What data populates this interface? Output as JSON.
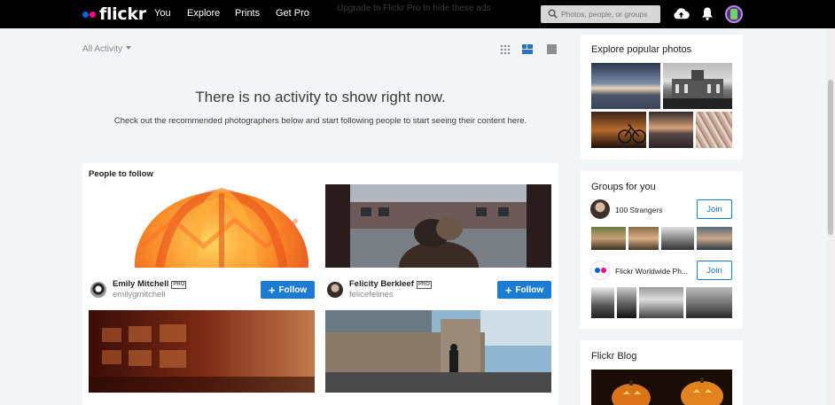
{
  "topbar": {
    "logo_text": "flickr",
    "nav": [
      "You",
      "Explore",
      "Prints",
      "Get Pro"
    ],
    "promo_text": "Upgrade to Flickr Pro to hide these ads",
    "search_placeholder": "Photos, people, or groups",
    "icons": [
      "upload-cloud-icon",
      "bell-icon",
      "user-avatar"
    ]
  },
  "feed": {
    "filter_label": "All Activity",
    "view_modes": [
      "grid-view-icon",
      "mosaic-view-icon",
      "single-view-icon"
    ],
    "empty_title": "There is no activity to show right now.",
    "empty_subtitle": "Check out the recommended photographers below and start following people to start seeing their content here."
  },
  "people_to_follow": {
    "title": "People to follow",
    "pro_badge": "PRO",
    "follow_label": "Follow",
    "people": [
      {
        "name": "Emily Mitchell",
        "username": "emilygmitchell"
      },
      {
        "name": "Felicity Berkleef",
        "username": "felicefelines"
      }
    ]
  },
  "explore": {
    "title": "Explore popular photos"
  },
  "groups": {
    "title": "Groups for you",
    "join_label": "Join",
    "items": [
      {
        "name": "100 Strangers"
      },
      {
        "name": "Flickr Worldwide Ph..."
      }
    ]
  },
  "blog": {
    "title": "Flickr Blog"
  },
  "colors": {
    "accent": "#1c7bd5",
    "flickr_blue": "#0063dc",
    "flickr_pink": "#ff0084",
    "topbar": "#000000",
    "page_bg": "#f2f5f6"
  }
}
